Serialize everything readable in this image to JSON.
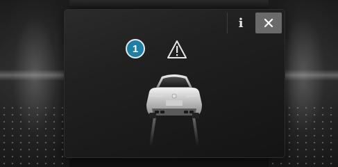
{
  "dialog": {
    "info_label": "i",
    "callout_number": "1",
    "icons": {
      "info": "info-icon",
      "close": "close-icon",
      "warning": "warning-triangle-icon",
      "vehicle": "car-rear-icon"
    }
  },
  "colors": {
    "callout_fill": "#1d7fa3",
    "close_button": "#6a6a6a",
    "dialog_background": "#1e1e1e"
  }
}
